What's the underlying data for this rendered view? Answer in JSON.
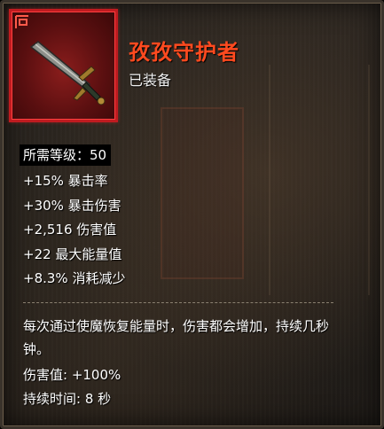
{
  "item": {
    "name": "孜孜守护者",
    "status": "已装备",
    "icon": "dagger-icon",
    "rarity_color": "#ff4a1f",
    "frame_color": "#c01b20"
  },
  "requirement": {
    "label": "所需等级：50"
  },
  "stats": [
    "+15% 暴击率",
    "+30% 暴击伤害",
    "+2,516 伤害值",
    "+22 最大能量值",
    "+8.3% 消耗减少"
  ],
  "description": {
    "line1": "每次通过使魔恢复能量时，伤害都会增加，持续几秒",
    "line2": "钟。",
    "damage": "伤害值: +100%",
    "duration": "持续时间: 8 秒"
  }
}
